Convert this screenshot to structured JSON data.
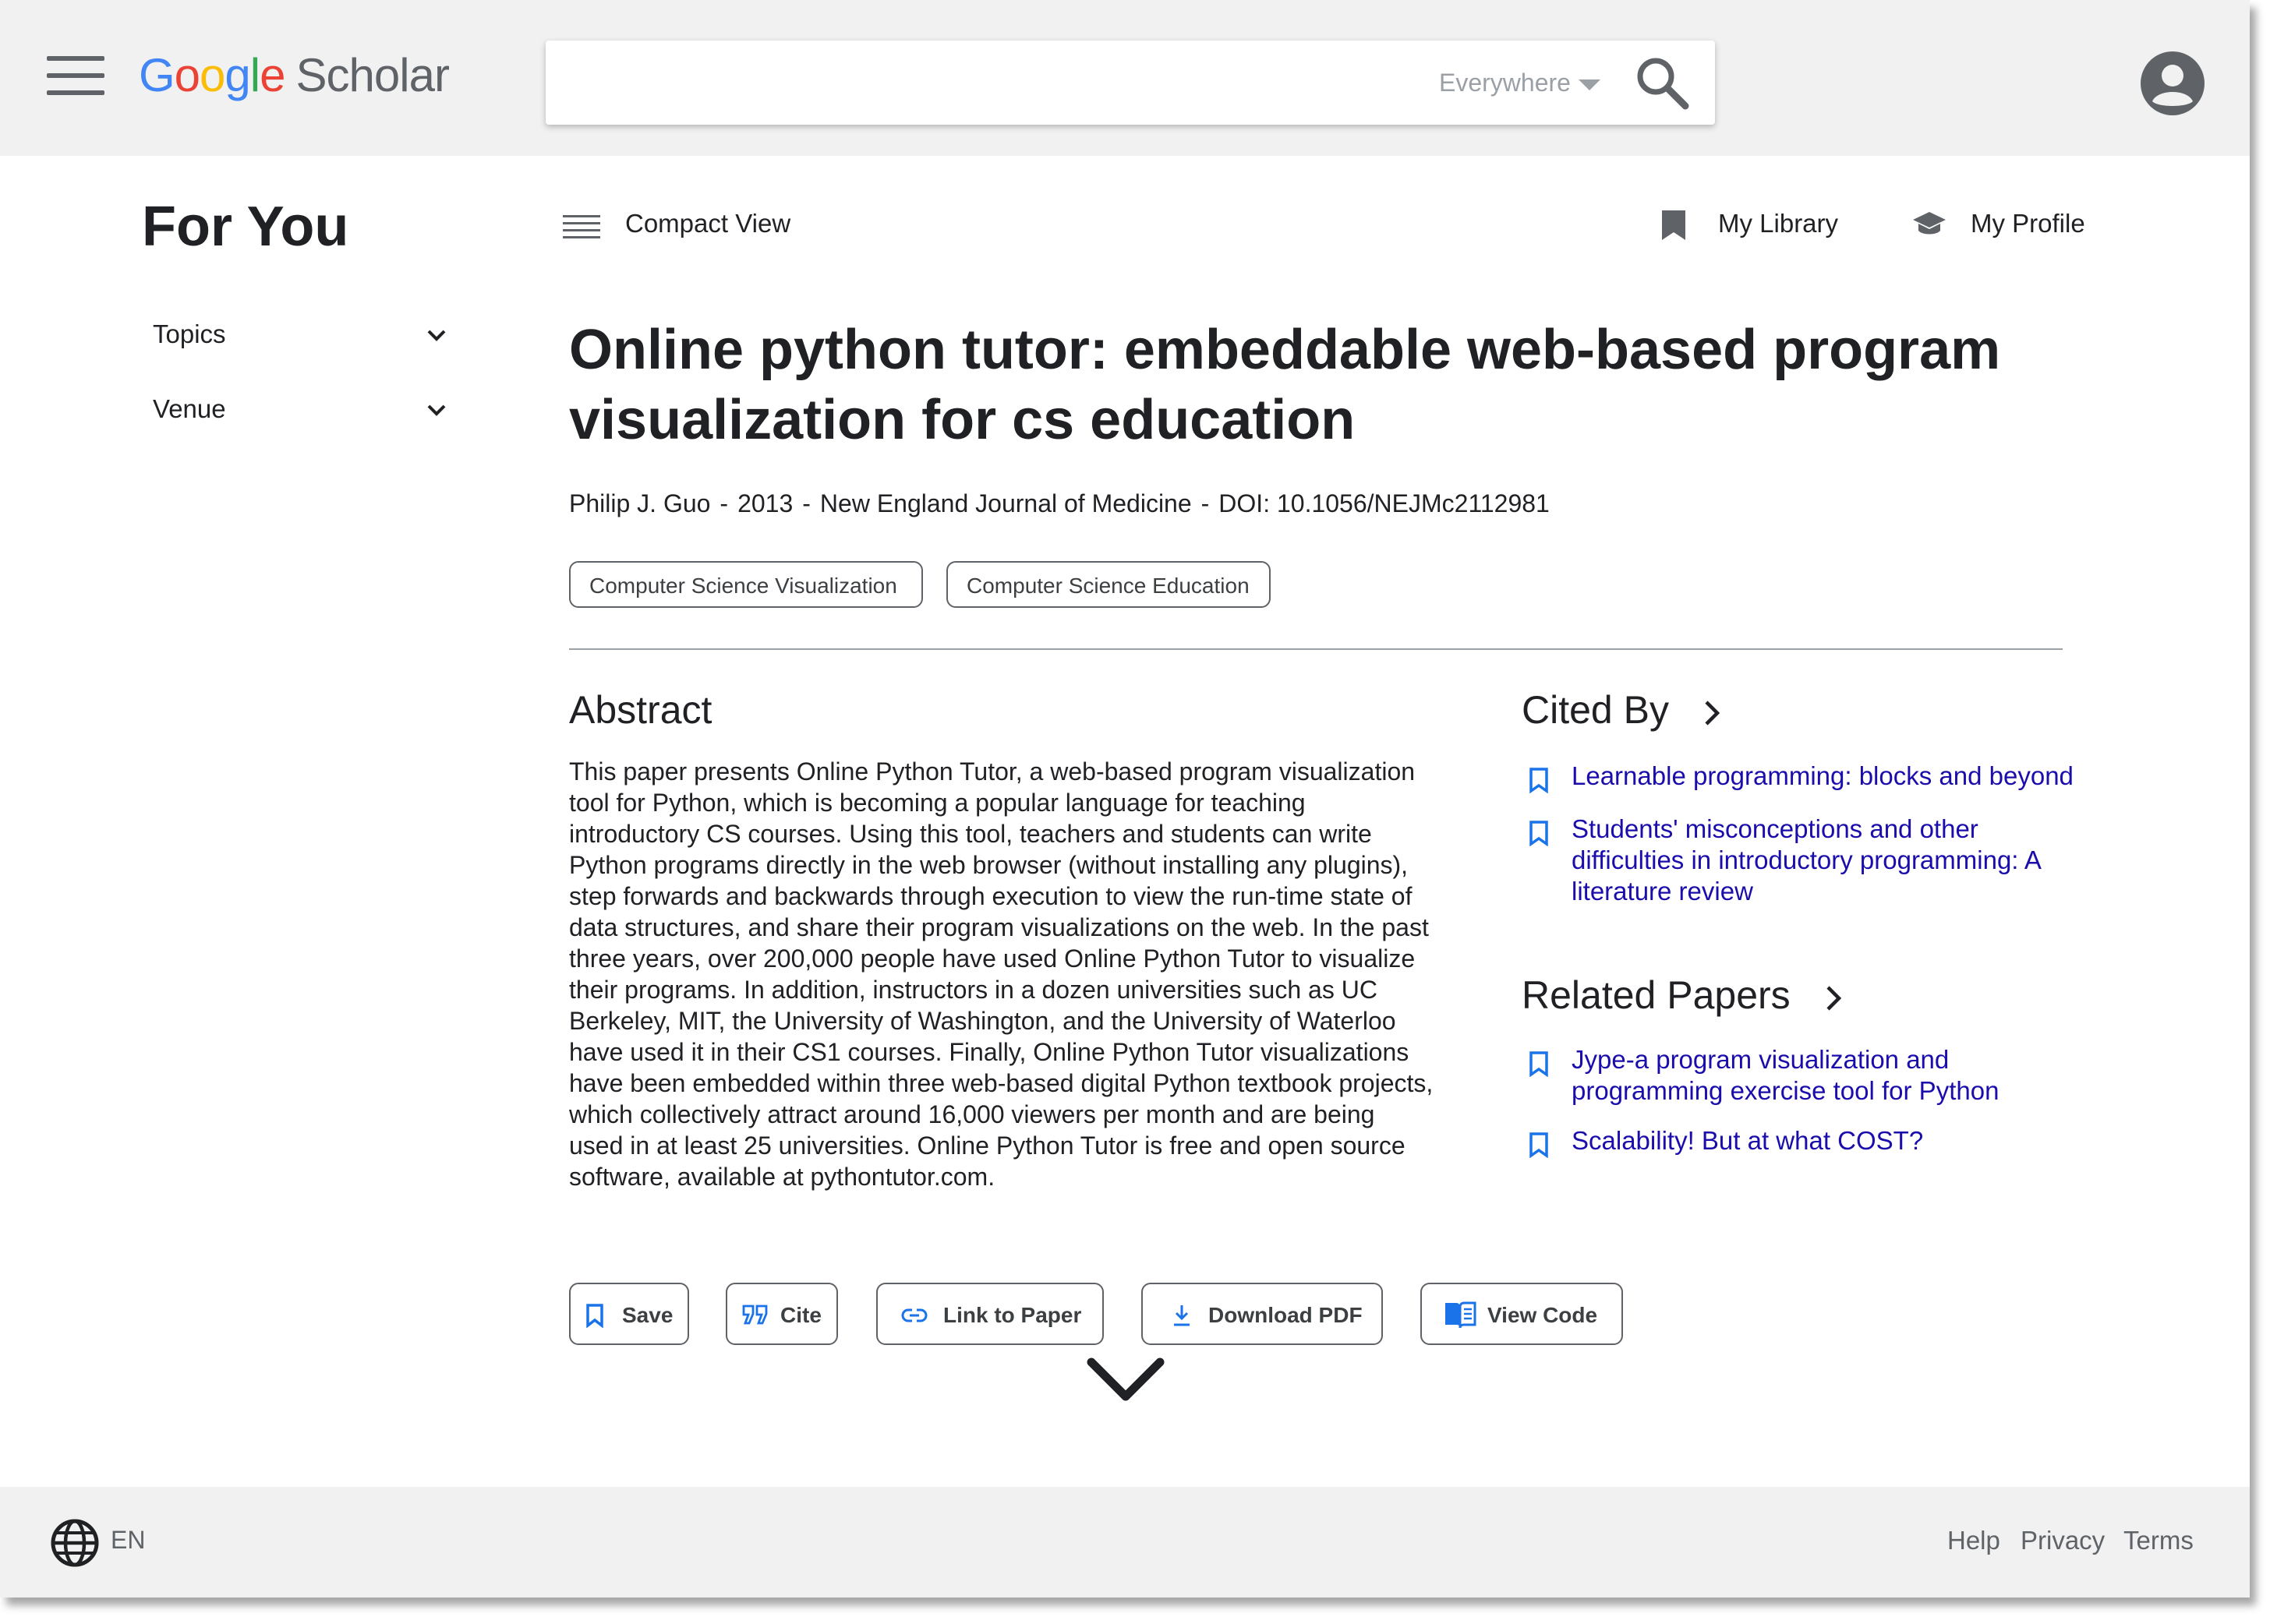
{
  "header": {
    "logo": {
      "google_letters": [
        "G",
        "o",
        "o",
        "g",
        "l",
        "e"
      ],
      "google_colors": [
        "#4285F4",
        "#EA4335",
        "#FBBC05",
        "#4285F4",
        "#34A853",
        "#EA4335"
      ],
      "product": "Scholar"
    },
    "search": {
      "value": "",
      "scope_label": "Everywhere"
    },
    "icons": {
      "menu": "hamburger-menu-icon",
      "search": "search-icon",
      "account": "account-icon"
    }
  },
  "sidebar": {
    "title": "For You",
    "filters": [
      {
        "label": "Topics"
      },
      {
        "label": "Venue"
      }
    ]
  },
  "toolbar": {
    "compact_view": "Compact View",
    "my_library": "My Library",
    "my_profile": "My Profile"
  },
  "paper": {
    "title": "Online python tutor: embeddable web-based program visualization for cs education",
    "author": "Philip J. Guo",
    "year": "2013",
    "venue": "New England Journal of Medicine",
    "doi": "DOI: 10.1056/NEJMc2112981",
    "meta_separator": "-",
    "tags": [
      "Computer Science Visualization",
      "Computer Science Education"
    ],
    "abstract_heading": "Abstract",
    "abstract": "This paper presents Online Python Tutor, a web-based program visualization tool for Python, which is becoming a popular language for teaching introductory CS courses. Using this tool, teachers and students can write Python programs directly in the web browser (without installing any plugins), step forwards and backwards through execution to view the run-time state of data structures, and share their program visualizations on the web. In the past three years, over 200,000 people have used Online Python Tutor to visualize their programs. In addition, instructors in a dozen universities such as UC Berkeley, MIT, the University of Washington, and the University of Waterloo have used it in their CS1 courses. Finally, Online Python Tutor visualizations have been embedded within three web-based digital Python textbook projects, which collectively attract around 16,000 viewers per month and are being used in at least 25 universities. Online Python Tutor is free and open source software, available at pythontutor.com."
  },
  "cited_by": {
    "heading": "Cited By",
    "items": [
      "Learnable programming: blocks and beyond",
      "Students' misconceptions and other difficulties in introductory programming: A literature review"
    ]
  },
  "related": {
    "heading": "Related Papers",
    "items": [
      "Jype-a program visualization and programming exercise tool for Python",
      "Scalability! But at what COST?"
    ]
  },
  "actions": [
    "Save",
    "Cite",
    "Link to Paper",
    "Download PDF",
    "View Code"
  ],
  "footer": {
    "language": "EN",
    "links": [
      "Help",
      "Privacy",
      "Terms"
    ]
  },
  "colors": {
    "link": "#1a0dab",
    "accent_blue": "#1a73e8",
    "gray_bar": "#f1f1f1",
    "icon_gray": "#5f6368"
  }
}
